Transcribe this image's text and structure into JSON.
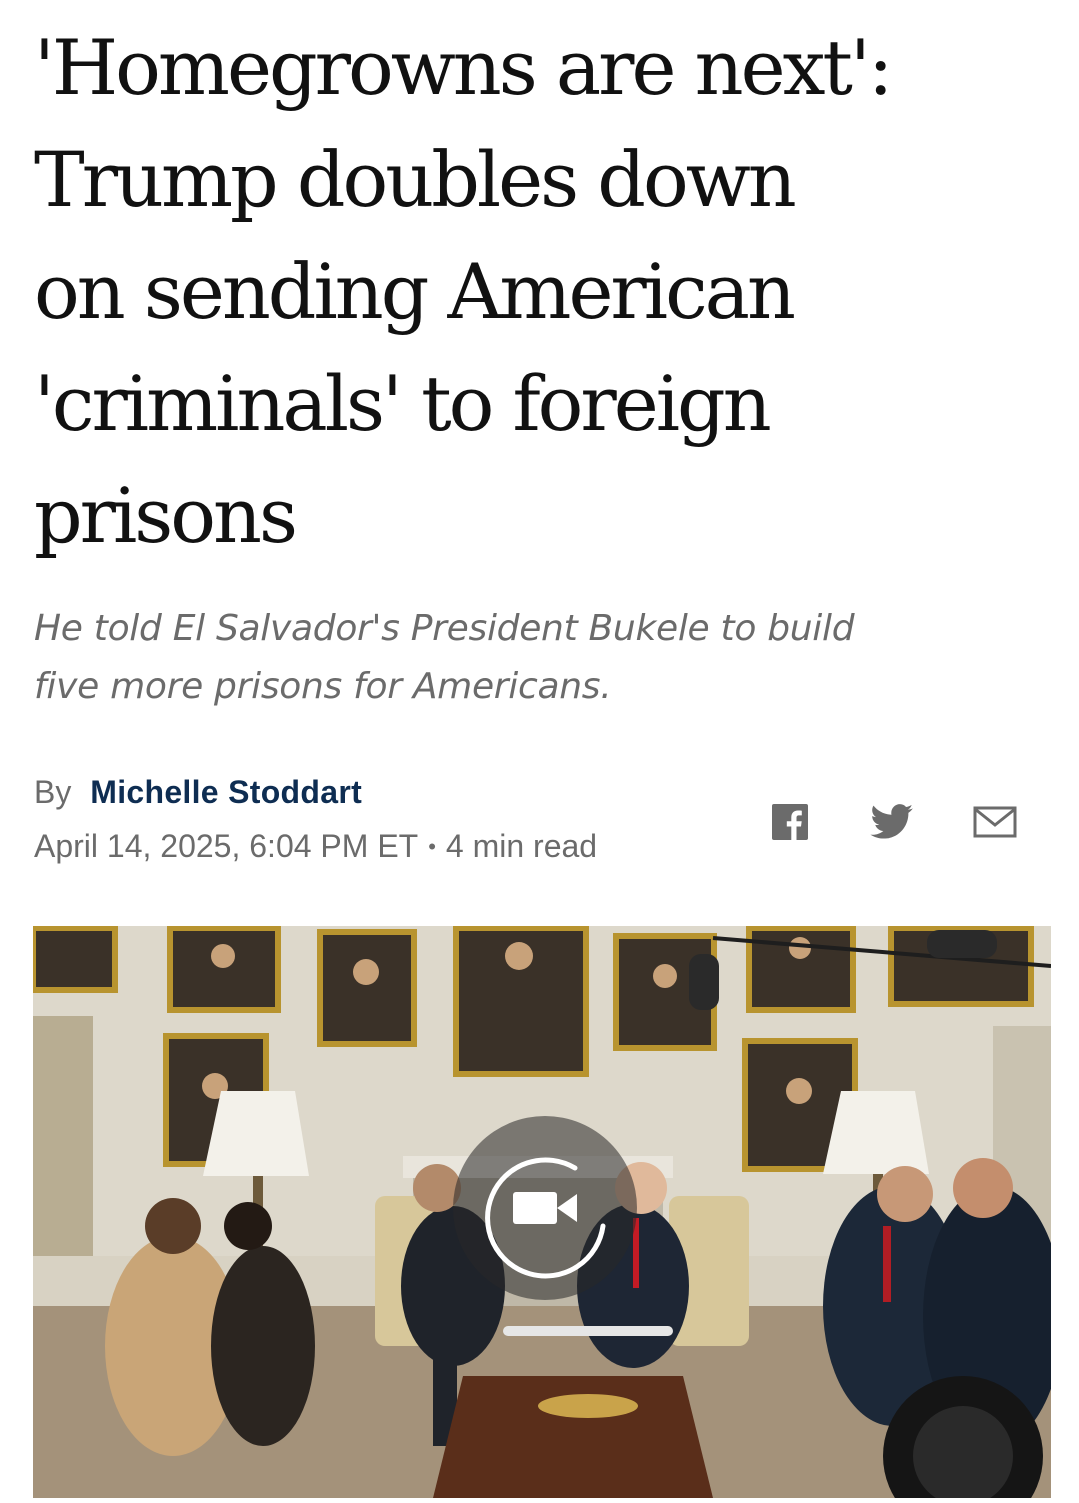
{
  "article": {
    "headline_lines": [
      "'Homegrowns are next':",
      "Trump doubles down",
      "on sending American",
      "'criminals' to foreign",
      "prisons"
    ],
    "dek_lines": [
      "He told El Salvador's President Bukele to build",
      "five more prisons for Americans."
    ],
    "byline": {
      "prefix": "By",
      "author": "Michelle Stoddart"
    },
    "meta": {
      "date": "April 14, 2025, 6:04 PM ET",
      "separator": "•",
      "read_time": "4 min read"
    },
    "share": {
      "icons": [
        "facebook-icon",
        "twitter-icon",
        "email-icon"
      ],
      "color": "#6b6b6b"
    },
    "hero": {
      "media_icon": "video-camera-icon"
    }
  },
  "colors": {
    "headline": "#111111",
    "dek": "#6b6b6b",
    "author": "#0e2d52",
    "meta": "#6b6b6b"
  }
}
